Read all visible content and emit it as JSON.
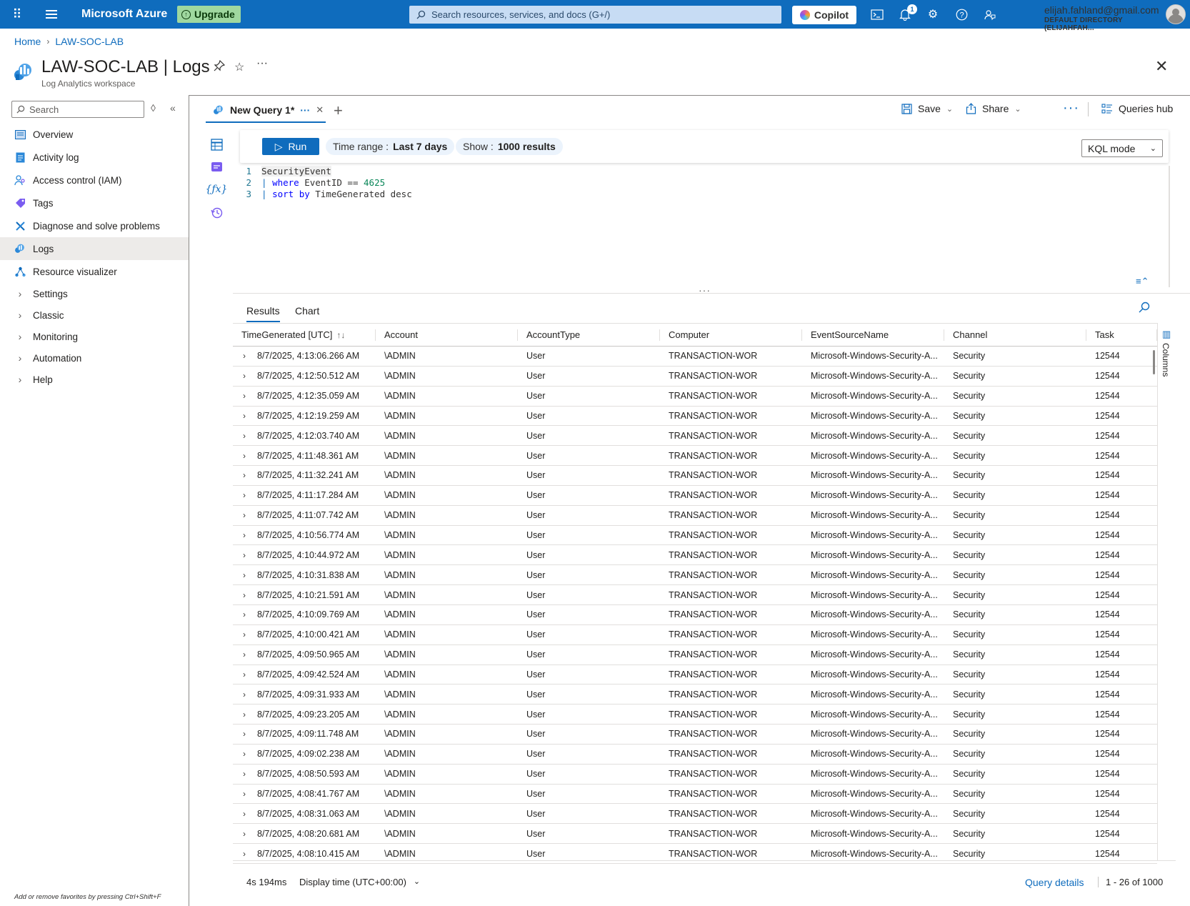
{
  "topbar": {
    "brand": "Microsoft Azure",
    "upgrade_label": "Upgrade",
    "search_placeholder": "Search resources, services, and docs (G+/)",
    "copilot_label": "Copilot",
    "notification_count": "1",
    "user_email": "elijah.fahland@gmail.com",
    "user_directory": "DEFAULT DIRECTORY (ELIJAHFAH..."
  },
  "breadcrumb": {
    "home": "Home",
    "current": "LAW-SOC-LAB"
  },
  "page": {
    "title": "LAW-SOC-LAB | Logs",
    "subtitle": "Log Analytics workspace"
  },
  "nav": {
    "search_placeholder": "Search",
    "items": [
      {
        "label": "Overview",
        "icon": "overview-icon"
      },
      {
        "label": "Activity log",
        "icon": "activity-log-icon"
      },
      {
        "label": "Access control (IAM)",
        "icon": "iam-icon"
      },
      {
        "label": "Tags",
        "icon": "tag-icon"
      },
      {
        "label": "Diagnose and solve problems",
        "icon": "wrench-icon"
      },
      {
        "label": "Logs",
        "icon": "logs-icon",
        "selected": true
      },
      {
        "label": "Resource visualizer",
        "icon": "visualizer-icon"
      }
    ],
    "groups": [
      "Settings",
      "Classic",
      "Monitoring",
      "Automation",
      "Help"
    ],
    "footer": "Add or remove favorites by pressing Ctrl+Shift+F"
  },
  "query_tab": {
    "label": "New Query 1*"
  },
  "toolbar": {
    "save_label": "Save",
    "share_label": "Share",
    "queries_hub_label": "Queries hub"
  },
  "query_bar": {
    "run_label": "Run",
    "time_range_label": "Time range :",
    "time_range_value": "Last 7 days",
    "show_label": "Show :",
    "show_value": "1000 results",
    "mode": "KQL mode"
  },
  "editor": {
    "lines": [
      {
        "num": "1",
        "text": "SecurityEvent"
      },
      {
        "num": "2",
        "text": "| where EventID == 4625"
      },
      {
        "num": "3",
        "text": "| sort by TimeGenerated desc"
      }
    ]
  },
  "results": {
    "tabs": [
      "Results",
      "Chart"
    ],
    "columns": [
      "TimeGenerated [UTC]",
      "Account",
      "AccountType",
      "Computer",
      "EventSourceName",
      "Channel",
      "Task"
    ],
    "side_label": "Columns",
    "rows": [
      [
        "8/7/2025, 4:13:06.266 AM",
        "\\ADMIN",
        "User",
        "TRANSACTION-WOR",
        "Microsoft-Windows-Security-A...",
        "Security",
        "12544"
      ],
      [
        "8/7/2025, 4:12:50.512 AM",
        "\\ADMIN",
        "User",
        "TRANSACTION-WOR",
        "Microsoft-Windows-Security-A...",
        "Security",
        "12544"
      ],
      [
        "8/7/2025, 4:12:35.059 AM",
        "\\ADMIN",
        "User",
        "TRANSACTION-WOR",
        "Microsoft-Windows-Security-A...",
        "Security",
        "12544"
      ],
      [
        "8/7/2025, 4:12:19.259 AM",
        "\\ADMIN",
        "User",
        "TRANSACTION-WOR",
        "Microsoft-Windows-Security-A...",
        "Security",
        "12544"
      ],
      [
        "8/7/2025, 4:12:03.740 AM",
        "\\ADMIN",
        "User",
        "TRANSACTION-WOR",
        "Microsoft-Windows-Security-A...",
        "Security",
        "12544"
      ],
      [
        "8/7/2025, 4:11:48.361 AM",
        "\\ADMIN",
        "User",
        "TRANSACTION-WOR",
        "Microsoft-Windows-Security-A...",
        "Security",
        "12544"
      ],
      [
        "8/7/2025, 4:11:32.241 AM",
        "\\ADMIN",
        "User",
        "TRANSACTION-WOR",
        "Microsoft-Windows-Security-A...",
        "Security",
        "12544"
      ],
      [
        "8/7/2025, 4:11:17.284 AM",
        "\\ADMIN",
        "User",
        "TRANSACTION-WOR",
        "Microsoft-Windows-Security-A...",
        "Security",
        "12544"
      ],
      [
        "8/7/2025, 4:11:07.742 AM",
        "\\ADMIN",
        "User",
        "TRANSACTION-WOR",
        "Microsoft-Windows-Security-A...",
        "Security",
        "12544"
      ],
      [
        "8/7/2025, 4:10:56.774 AM",
        "\\ADMIN",
        "User",
        "TRANSACTION-WOR",
        "Microsoft-Windows-Security-A...",
        "Security",
        "12544"
      ],
      [
        "8/7/2025, 4:10:44.972 AM",
        "\\ADMIN",
        "User",
        "TRANSACTION-WOR",
        "Microsoft-Windows-Security-A...",
        "Security",
        "12544"
      ],
      [
        "8/7/2025, 4:10:31.838 AM",
        "\\ADMIN",
        "User",
        "TRANSACTION-WOR",
        "Microsoft-Windows-Security-A...",
        "Security",
        "12544"
      ],
      [
        "8/7/2025, 4:10:21.591 AM",
        "\\ADMIN",
        "User",
        "TRANSACTION-WOR",
        "Microsoft-Windows-Security-A...",
        "Security",
        "12544"
      ],
      [
        "8/7/2025, 4:10:09.769 AM",
        "\\ADMIN",
        "User",
        "TRANSACTION-WOR",
        "Microsoft-Windows-Security-A...",
        "Security",
        "12544"
      ],
      [
        "8/7/2025, 4:10:00.421 AM",
        "\\ADMIN",
        "User",
        "TRANSACTION-WOR",
        "Microsoft-Windows-Security-A...",
        "Security",
        "12544"
      ],
      [
        "8/7/2025, 4:09:50.965 AM",
        "\\ADMIN",
        "User",
        "TRANSACTION-WOR",
        "Microsoft-Windows-Security-A...",
        "Security",
        "12544"
      ],
      [
        "8/7/2025, 4:09:42.524 AM",
        "\\ADMIN",
        "User",
        "TRANSACTION-WOR",
        "Microsoft-Windows-Security-A...",
        "Security",
        "12544"
      ],
      [
        "8/7/2025, 4:09:31.933 AM",
        "\\ADMIN",
        "User",
        "TRANSACTION-WOR",
        "Microsoft-Windows-Security-A...",
        "Security",
        "12544"
      ],
      [
        "8/7/2025, 4:09:23.205 AM",
        "\\ADMIN",
        "User",
        "TRANSACTION-WOR",
        "Microsoft-Windows-Security-A...",
        "Security",
        "12544"
      ],
      [
        "8/7/2025, 4:09:11.748 AM",
        "\\ADMIN",
        "User",
        "TRANSACTION-WOR",
        "Microsoft-Windows-Security-A...",
        "Security",
        "12544"
      ],
      [
        "8/7/2025, 4:09:02.238 AM",
        "\\ADMIN",
        "User",
        "TRANSACTION-WOR",
        "Microsoft-Windows-Security-A...",
        "Security",
        "12544"
      ],
      [
        "8/7/2025, 4:08:50.593 AM",
        "\\ADMIN",
        "User",
        "TRANSACTION-WOR",
        "Microsoft-Windows-Security-A...",
        "Security",
        "12544"
      ],
      [
        "8/7/2025, 4:08:41.767 AM",
        "\\ADMIN",
        "User",
        "TRANSACTION-WOR",
        "Microsoft-Windows-Security-A...",
        "Security",
        "12544"
      ],
      [
        "8/7/2025, 4:08:31.063 AM",
        "\\ADMIN",
        "User",
        "TRANSACTION-WOR",
        "Microsoft-Windows-Security-A...",
        "Security",
        "12544"
      ],
      [
        "8/7/2025, 4:08:20.681 AM",
        "\\ADMIN",
        "User",
        "TRANSACTION-WOR",
        "Microsoft-Windows-Security-A...",
        "Security",
        "12544"
      ],
      [
        "8/7/2025, 4:08:10.415 AM",
        "\\ADMIN",
        "User",
        "TRANSACTION-WOR",
        "Microsoft-Windows-Security-A...",
        "Security",
        "12544"
      ]
    ]
  },
  "status": {
    "duration": "4s 194ms",
    "display_time": "Display time (UTC+00:00)",
    "query_details": "Query details",
    "paging": "1 - 26 of 1000"
  },
  "colors": {
    "accent": "#0f6cbd",
    "topbar": "#0f6cbd",
    "upgrade": "#9fd89f"
  }
}
